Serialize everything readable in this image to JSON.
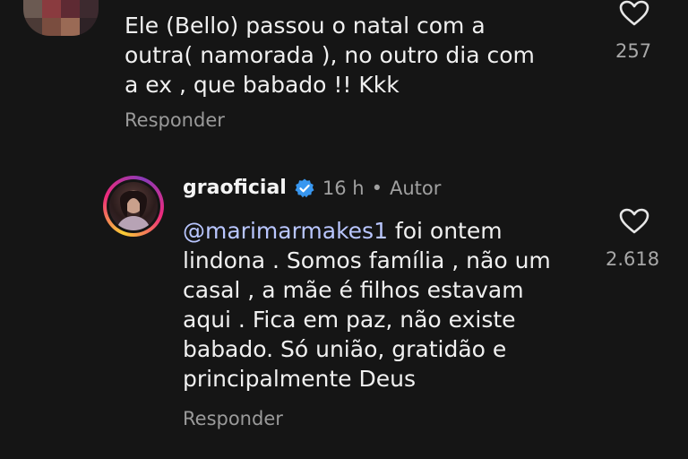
{
  "comment_1": {
    "text": "Ele (Bello) passou o natal com a\noutra( namorada ), no outro dia com\na ex , que babado !! Kkk",
    "reply_label": "Responder",
    "likes": "257"
  },
  "comment_2": {
    "username": "graoficial",
    "time": "16 h",
    "separator": "•",
    "author_tag": "Autor",
    "mention": "@marimarmakes1",
    "text_after_mention": " foi ontem\nlindona . Somos família , não um\ncasal , a mãe é filhos estavam\naqui . Fica em paz, não existe\nbabado. Só união, gratidão e\nprincipalmente Deus",
    "reply_label": "Responder",
    "likes": "2.618"
  },
  "icons": {
    "like": "heart-outline-icon",
    "verified": "verified-badge-icon"
  },
  "colors": {
    "background": "#151515",
    "mention": "#b9c6ff",
    "verified": "#3897f0",
    "secondary_text": "#a0a0a0"
  }
}
